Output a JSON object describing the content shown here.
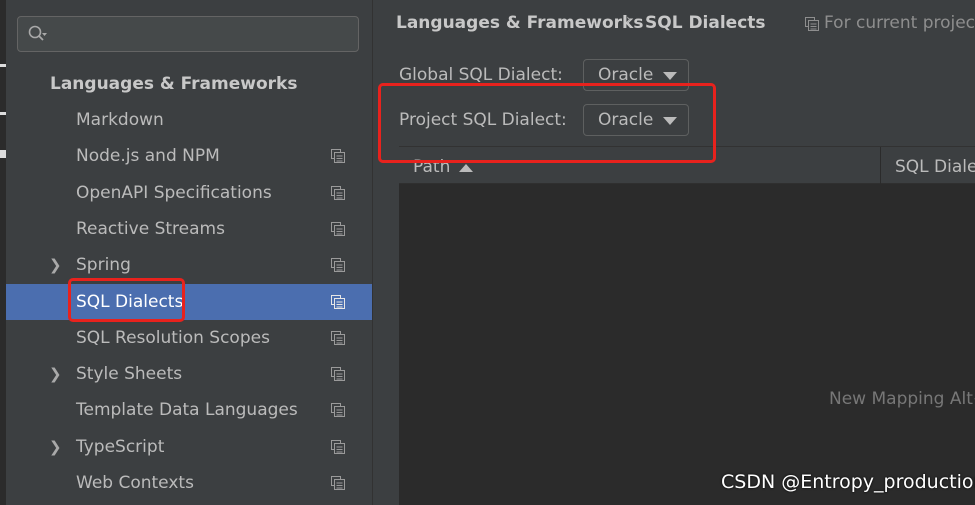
{
  "sidebar": {
    "search": {
      "icon": "search-icon"
    },
    "section_title": "Languages & Frameworks",
    "items": [
      {
        "label": "Markdown",
        "has_arrow": false,
        "has_scope_icon": false,
        "selected": false
      },
      {
        "label": "Node.js and NPM",
        "has_arrow": false,
        "has_scope_icon": true,
        "selected": false
      },
      {
        "label": "OpenAPI Specifications",
        "has_arrow": false,
        "has_scope_icon": true,
        "selected": false
      },
      {
        "label": "Reactive Streams",
        "has_arrow": false,
        "has_scope_icon": true,
        "selected": false
      },
      {
        "label": "Spring",
        "has_arrow": true,
        "has_scope_icon": true,
        "selected": false
      },
      {
        "label": "SQL Dialects",
        "has_arrow": false,
        "has_scope_icon": true,
        "selected": true
      },
      {
        "label": "SQL Resolution Scopes",
        "has_arrow": false,
        "has_scope_icon": true,
        "selected": false
      },
      {
        "label": "Style Sheets",
        "has_arrow": true,
        "has_scope_icon": true,
        "selected": false
      },
      {
        "label": "Template Data Languages",
        "has_arrow": false,
        "has_scope_icon": true,
        "selected": false
      },
      {
        "label": "TypeScript",
        "has_arrow": true,
        "has_scope_icon": true,
        "selected": false
      },
      {
        "label": "Web Contexts",
        "has_arrow": false,
        "has_scope_icon": true,
        "selected": false
      }
    ]
  },
  "breadcrumb": {
    "parent": "Languages & Frameworks",
    "separator": "›",
    "current": "SQL Dialects",
    "scope_note": "For current project"
  },
  "global_dialect": {
    "label": "Global SQL Dialect:",
    "value": "Oracle"
  },
  "project_dialect": {
    "label": "Project SQL Dialect:",
    "value": "Oracle"
  },
  "table": {
    "columns": [
      "Path",
      "SQL Dialect"
    ],
    "empty_text": "New Mapping Alt+Insert"
  },
  "watermark": "CSDN @Entropy_production",
  "colors": {
    "accent_selection": "#4b6eaf",
    "highlight_red": "#e8221d",
    "background": "#3c3f41"
  }
}
